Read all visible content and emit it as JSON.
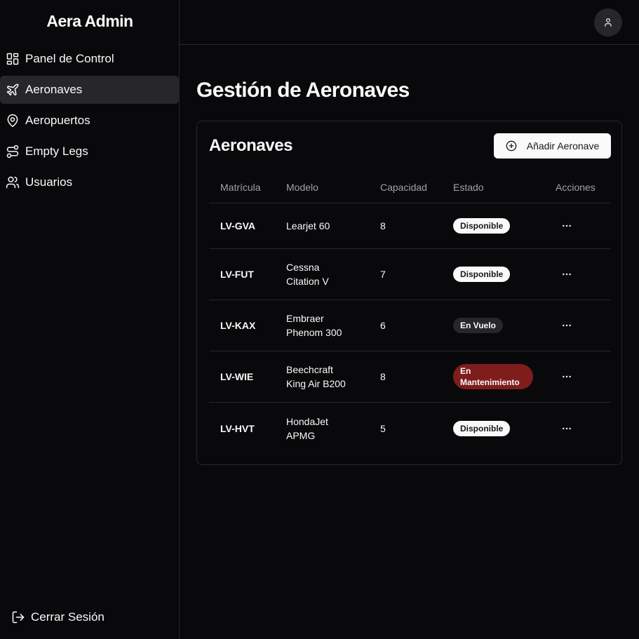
{
  "brand": "Aera Admin",
  "sidebar": {
    "items": [
      {
        "label": "Panel de Control",
        "icon": "layout-dashboard-icon"
      },
      {
        "label": "Aeronaves",
        "icon": "plane-icon"
      },
      {
        "label": "Aeropuertos",
        "icon": "map-pin-icon"
      },
      {
        "label": "Empty Legs",
        "icon": "route-icon"
      },
      {
        "label": "Usuarios",
        "icon": "users-icon"
      }
    ],
    "active": "Aeronaves",
    "logout": {
      "label": "Cerrar Sesión",
      "icon": "log-out-icon"
    }
  },
  "header": {
    "avatar_icon": "user-icon"
  },
  "page": {
    "title": "Gestión de Aeronaves"
  },
  "card": {
    "title": "Aeronaves",
    "add_button": {
      "label": "Añadir Aeronave",
      "icon": "plus-circle-icon"
    }
  },
  "table": {
    "headers": {
      "registration": "Matrícula",
      "model": "Modelo",
      "capacity": "Capacidad",
      "status": "Estado",
      "actions": "Acciones"
    },
    "rows": [
      {
        "registration": "LV-GVA",
        "model_line1": "Learjet 60",
        "model_line2": "",
        "capacity": "8",
        "status": "Disponible"
      },
      {
        "registration": "LV-FUT",
        "model_line1": "Cessna",
        "model_line2": "Citation V",
        "capacity": "7",
        "status": "Disponible"
      },
      {
        "registration": "LV-KAX",
        "model_line1": "Embraer",
        "model_line2": "Phenom 300",
        "capacity": "6",
        "status": "En Vuelo"
      },
      {
        "registration": "LV-WIE",
        "model_line1": "Beechcraft",
        "model_line2": "King Air B200",
        "capacity": "8",
        "status_line1": "En",
        "status_line2": "Mantenimiento"
      },
      {
        "registration": "LV-HVT",
        "model_line1": "HondaJet",
        "model_line2": "APMG",
        "capacity": "5",
        "status": "Disponible"
      }
    ]
  },
  "colors": {
    "background": "#09090b",
    "border": "#27272a",
    "active_nav": "#27272a",
    "muted_text": "#a1a1aa",
    "maintenance_badge": "#7f1d1d"
  }
}
